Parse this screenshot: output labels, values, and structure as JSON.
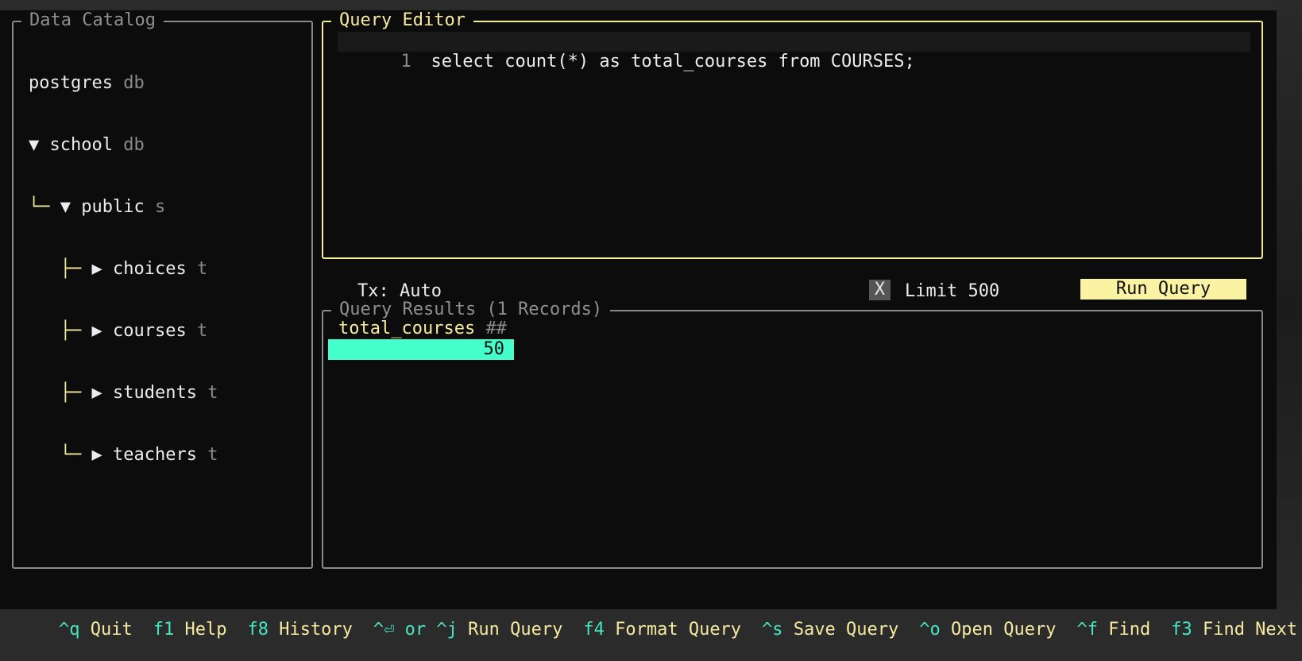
{
  "catalog": {
    "title": "Data Catalog",
    "tree": [
      {
        "prefix": "",
        "guide": "",
        "name": "postgres",
        "kind": "db"
      },
      {
        "prefix": "▼ ",
        "guide": "",
        "name": "school",
        "kind": "db"
      },
      {
        "prefix": "▼ ",
        "guide": "└─ ",
        "name": "public",
        "kind": "s"
      },
      {
        "prefix": "▶ ",
        "guide": "   ├─ ",
        "name": "choices",
        "kind": "t"
      },
      {
        "prefix": "▶ ",
        "guide": "   ├─ ",
        "name": "courses",
        "kind": "t"
      },
      {
        "prefix": "▶ ",
        "guide": "   ├─ ",
        "name": "students",
        "kind": "t"
      },
      {
        "prefix": "▶ ",
        "guide": "   └─ ",
        "name": "teachers",
        "kind": "t"
      }
    ]
  },
  "editor": {
    "title": "Query Editor",
    "line_number": "1",
    "code": "select count(*) as total_courses from COURSES;"
  },
  "toolbar": {
    "tx": "Tx: Auto",
    "limit_check": "X",
    "limit_label": "Limit 500",
    "run_label": "Run Query"
  },
  "results": {
    "title": "Query Results (1 Records)",
    "column_name": "total_courses",
    "column_type": "##",
    "value": "50"
  },
  "footer": [
    {
      "key": "^q",
      "desc": "Quit"
    },
    {
      "key": "f1",
      "desc": "Help"
    },
    {
      "key": "f8",
      "desc": "History"
    },
    {
      "key": "^⏎ or ^j",
      "desc": "Run Query"
    },
    {
      "key": "f4",
      "desc": "Format Query"
    },
    {
      "key": "^s",
      "desc": "Save Query"
    },
    {
      "key": "^o",
      "desc": "Open Query"
    },
    {
      "key": "^f",
      "desc": "Find"
    },
    {
      "key": "f3",
      "desc": "Find Next"
    },
    {
      "key": "^",
      "desc": ""
    }
  ]
}
